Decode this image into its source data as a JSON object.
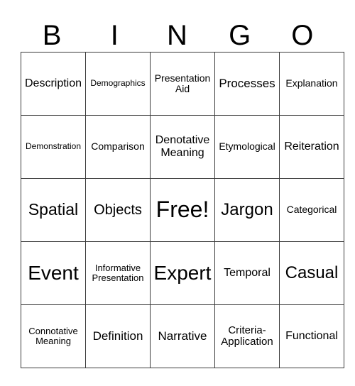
{
  "header": {
    "letters": [
      "B",
      "I",
      "N",
      "G",
      "O"
    ]
  },
  "card": {
    "rows": [
      [
        "Description",
        "Demographics",
        "Presentation Aid",
        "Processes",
        "Explanation"
      ],
      [
        "Demonstration",
        "Comparison",
        "Denotative Meaning",
        "Etymological",
        "Reiteration"
      ],
      [
        "Spatial",
        "Objects",
        "Free!",
        "Jargon",
        "Categorical"
      ],
      [
        "Event",
        "Informative Presentation",
        "Expert",
        "Temporal",
        "Casual"
      ],
      [
        "Connotative Meaning",
        "Definition",
        "Narrative",
        "Criteria-Application",
        "Functional"
      ]
    ]
  }
}
